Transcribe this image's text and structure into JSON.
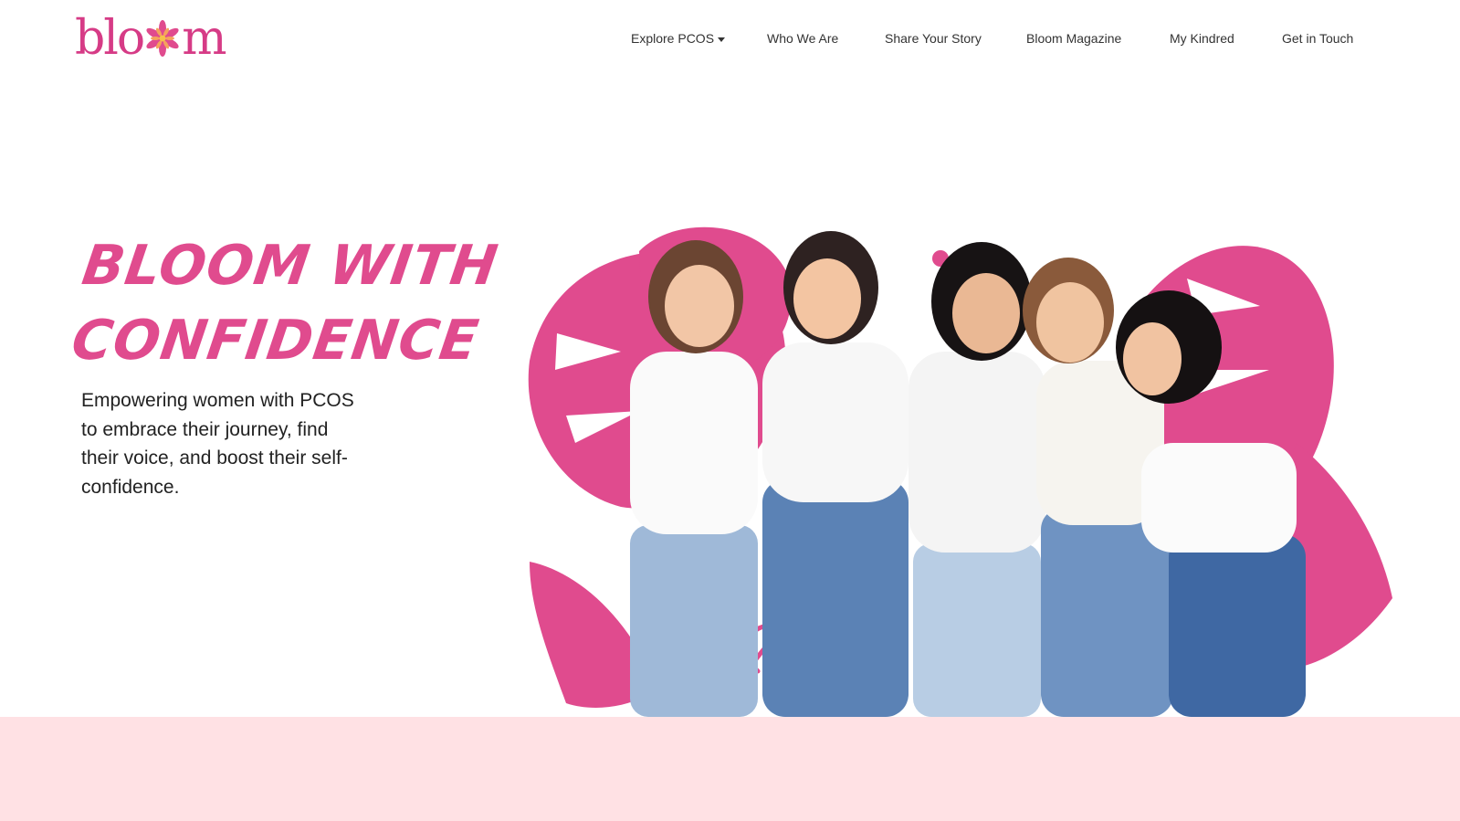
{
  "brand": {
    "logo_text_left": "blo",
    "logo_text_right": "m",
    "logo_icon": "flower-icon",
    "accent_color": "#d63b86",
    "leaf_color": "#e04b8e",
    "band_color": "#ffe1e4"
  },
  "nav": {
    "items": [
      {
        "label": "Explore PCOS",
        "has_dropdown": true
      },
      {
        "label": "Who We Are"
      },
      {
        "label": "Share Your Story"
      },
      {
        "label": "Bloom Magazine"
      },
      {
        "label": "My Kindred"
      },
      {
        "label": "Get in Touch"
      }
    ]
  },
  "hero": {
    "title_line1": "BLOOM WITH",
    "title_line2": "CONFIDENCE",
    "subtitle": "Empowering women with PCOS to embrace their journey, find their voice, and boost their self-confidence."
  }
}
